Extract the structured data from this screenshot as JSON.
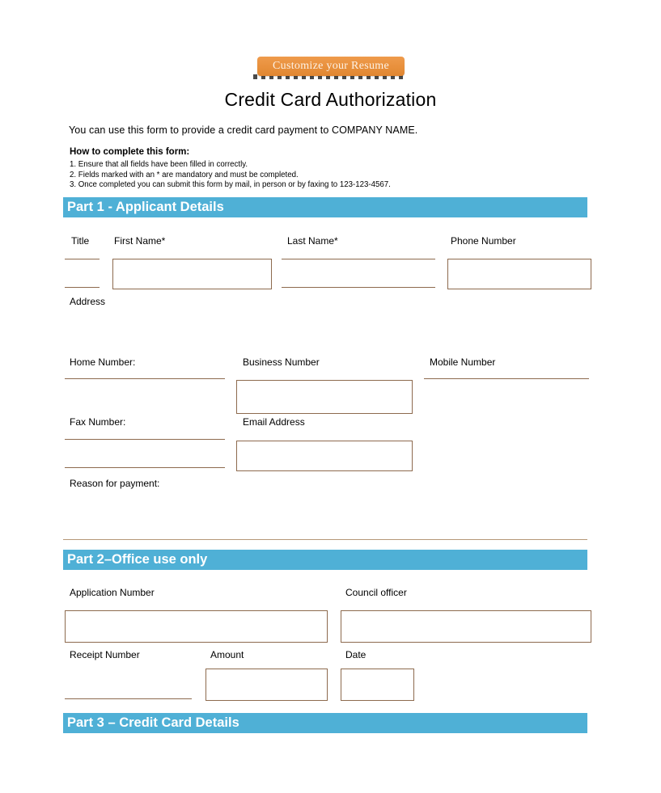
{
  "cta": {
    "label": "Customize your Resume",
    "button_color": "#e8903c",
    "text_color": "#fdf2e6"
  },
  "document": {
    "title": "Credit Card Authorization",
    "intro": "You can use this form to provide a credit card payment to COMPANY NAME."
  },
  "howto": {
    "heading": "How to complete this form:",
    "steps": [
      "1. Ensure that all fields have been filled in correctly.",
      "2. Fields marked with an * are mandatory and must be completed.",
      "3. Once completed you can submit this form by mail, in person or by faxing to 123-123-4567."
    ]
  },
  "sections": {
    "part1": "Part 1 - Applicant Details",
    "part2": "Part 2–Office use only",
    "part3": "Part 3 – Credit Card Details"
  },
  "part1_fields": {
    "title": "Title",
    "first_name": "First Name*",
    "last_name": "Last Name*",
    "phone_number": "Phone Number",
    "address": "Address",
    "home_number": "Home Number:",
    "business_number": "Business Number",
    "mobile_number": "Mobile Number",
    "fax_number": "Fax Number:",
    "email_address": "Email Address",
    "reason_for_payment": "Reason for payment:"
  },
  "part2_fields": {
    "application_number": "Application Number",
    "council_officer": "Council officer",
    "receipt_number": "Receipt Number",
    "amount": "Amount",
    "date": "Date"
  },
  "values": {
    "title": "",
    "first_name": "",
    "last_name": "",
    "phone_number": "",
    "address": "",
    "home_number": "",
    "business_number": "",
    "mobile_number": "",
    "fax_number": "",
    "email_address": "",
    "reason_for_payment": "",
    "application_number": "",
    "council_officer": "",
    "receipt_number": "",
    "amount": "",
    "date": ""
  },
  "theme": {
    "section_bar_color": "#4fb0d6",
    "field_border_color": "#8d6a4e",
    "divider_color": "#b59877"
  }
}
